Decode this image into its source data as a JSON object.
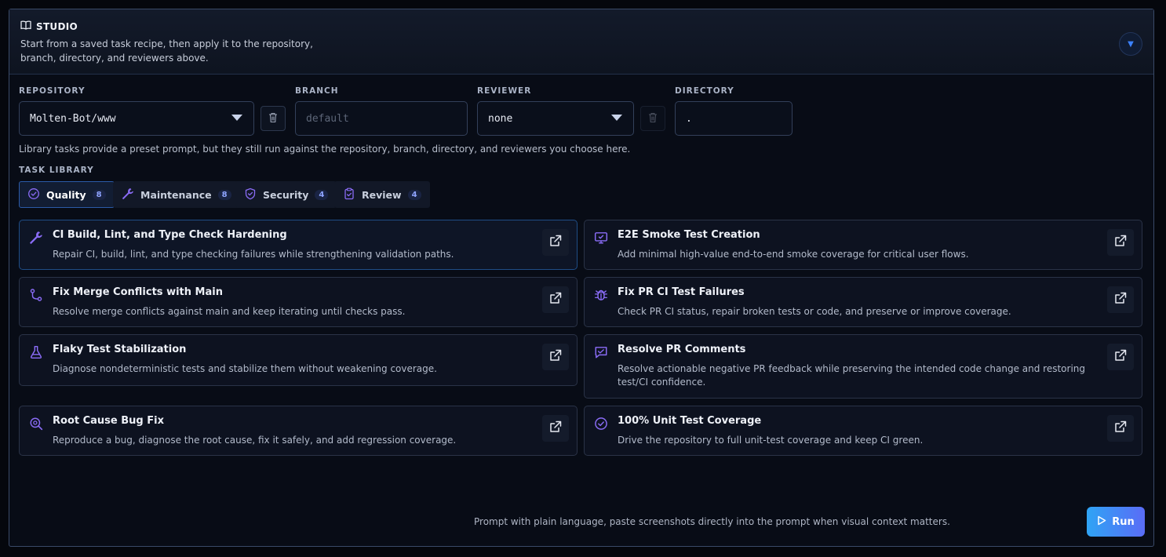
{
  "header": {
    "title": "STUDIO",
    "description": "Start from a saved task recipe, then apply it to the repository, branch, directory, and reviewers above."
  },
  "fields": {
    "repository_label": "REPOSITORY",
    "repository_value": "Molten-Bot/www",
    "branch_label": "BRANCH",
    "branch_placeholder": "default",
    "reviewer_label": "REVIEWER",
    "reviewer_value": "none",
    "directory_label": "DIRECTORY",
    "directory_value": "."
  },
  "hint": "Library tasks provide a preset prompt, but they still run against the repository, branch, directory, and reviewers you choose here.",
  "library": {
    "label": "TASK LIBRARY",
    "tabs": [
      {
        "label": "Quality",
        "count": "8",
        "icon": "check-circle-icon"
      },
      {
        "label": "Maintenance",
        "count": "8",
        "icon": "wrench-icon"
      },
      {
        "label": "Security",
        "count": "4",
        "icon": "shield-icon"
      },
      {
        "label": "Review",
        "count": "4",
        "icon": "clipboard-icon"
      }
    ],
    "cards": [
      {
        "title": "CI Build, Lint, and Type Check Hardening",
        "desc": "Repair CI, build, lint, and type checking failures while strengthening validation paths.",
        "icon": "wrench-icon"
      },
      {
        "title": "E2E Smoke Test Creation",
        "desc": "Add minimal high-value end-to-end smoke coverage for critical user flows.",
        "icon": "monitor-icon"
      },
      {
        "title": "Fix Merge Conflicts with Main",
        "desc": "Resolve merge conflicts against main and keep iterating until checks pass.",
        "icon": "git-merge-icon"
      },
      {
        "title": "Fix PR CI Test Failures",
        "desc": "Check PR CI status, repair broken tests or code, and preserve or improve coverage.",
        "icon": "bug-icon"
      },
      {
        "title": "Flaky Test Stabilization",
        "desc": "Diagnose nondeterministic tests and stabilize them without weakening coverage.",
        "icon": "flask-icon"
      },
      {
        "title": "Resolve PR Comments",
        "desc": "Resolve actionable negative PR feedback while preserving the intended code change and restoring test/CI confidence.",
        "icon": "message-icon"
      },
      {
        "title": "Root Cause Bug Fix",
        "desc": "Reproduce a bug, diagnose the root cause, fix it safely, and add regression coverage.",
        "icon": "search-bug-icon"
      },
      {
        "title": "100% Unit Test Coverage",
        "desc": "Drive the repository to full unit-test coverage and keep CI green.",
        "icon": "check-circle-icon"
      }
    ]
  },
  "footer": {
    "note": "Prompt with plain language, paste screenshots directly into the prompt when visual context matters.",
    "run_label": "Run"
  },
  "colors": {
    "accent": "#8a6cf6",
    "run_gradient_start": "#2fa4f5",
    "run_gradient_end": "#5a6cf6"
  }
}
